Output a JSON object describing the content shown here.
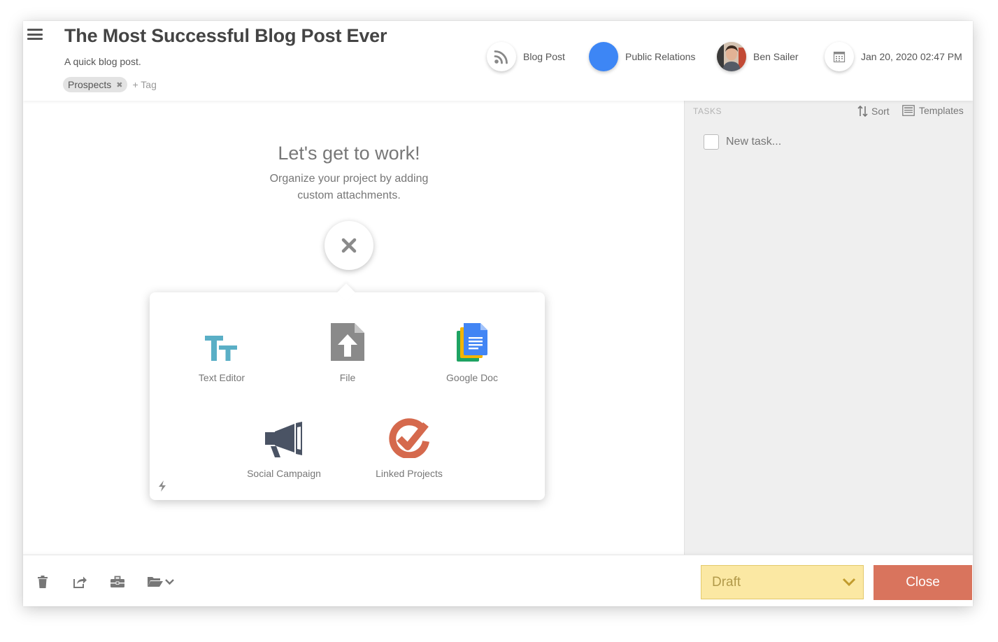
{
  "header": {
    "title": "The Most Successful Blog Post Ever",
    "subtitle": "A quick blog post.",
    "tags": [
      "Prospects"
    ],
    "add_tag_label": "+ Tag",
    "type_label": "Blog Post",
    "category_label": "Public Relations",
    "category_color": "#3d86f5",
    "owner_label": "Ben Sailer",
    "due_date": "Jan 20, 2020 02:47 PM"
  },
  "main": {
    "empty_title": "Let's get to work!",
    "empty_description": "Organize your project by adding custom attachments.",
    "attachments": [
      {
        "label": "Text Editor",
        "icon": "text-editor-icon",
        "color": "#5aafc6"
      },
      {
        "label": "File",
        "icon": "file-upload-icon",
        "color": "#8a8a8a"
      },
      {
        "label": "Google Doc",
        "icon": "google-doc-icon",
        "color": "#4285f4"
      },
      {
        "label": "Social Campaign",
        "icon": "megaphone-icon",
        "color": "#4a5364"
      },
      {
        "label": "Linked Projects",
        "icon": "linked-projects-icon",
        "color": "#d5694d"
      }
    ]
  },
  "tasks": {
    "heading": "TASKS",
    "sort_label": "Sort",
    "templates_label": "Templates",
    "new_task_placeholder": "New task..."
  },
  "footer": {
    "status_value": "Draft",
    "close_label": "Close",
    "status_color": "#fbe8a3",
    "close_color": "#d9745d"
  }
}
